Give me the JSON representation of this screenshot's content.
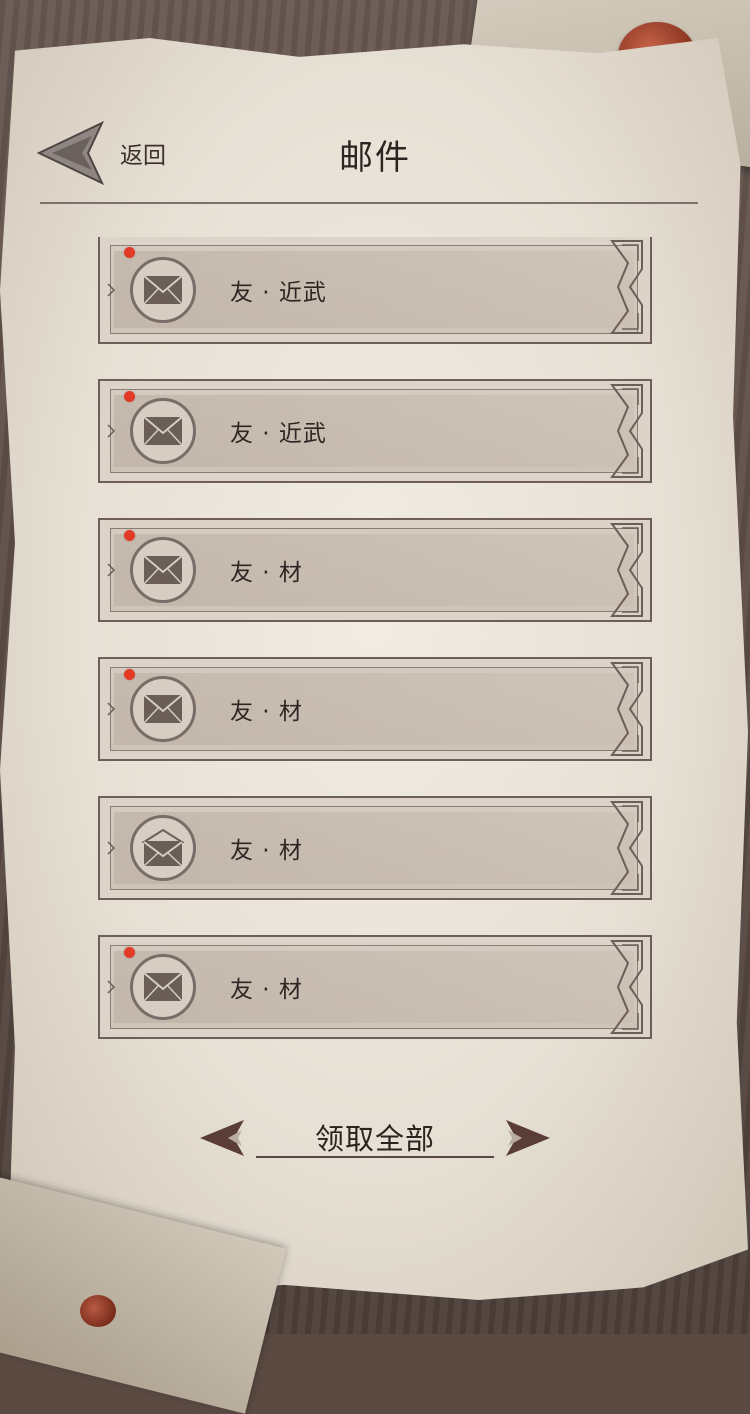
{
  "header": {
    "back_label": "返回",
    "title": "邮件"
  },
  "mails": [
    {
      "sender": "友 · 近武",
      "unread": true,
      "opened": false
    },
    {
      "sender": "友 · 近武",
      "unread": true,
      "opened": false
    },
    {
      "sender": "友 · 材",
      "unread": true,
      "opened": false
    },
    {
      "sender": "友 · 材",
      "unread": true,
      "opened": false
    },
    {
      "sender": "友 · 材",
      "unread": false,
      "opened": true
    },
    {
      "sender": "友 · 材",
      "unread": true,
      "opened": false
    }
  ],
  "footer": {
    "claim_all_label": "领取全部"
  },
  "colors": {
    "unread_dot": "#e33a25",
    "frame": "#6e5e59",
    "ornament_dark": "#5a3c38"
  }
}
